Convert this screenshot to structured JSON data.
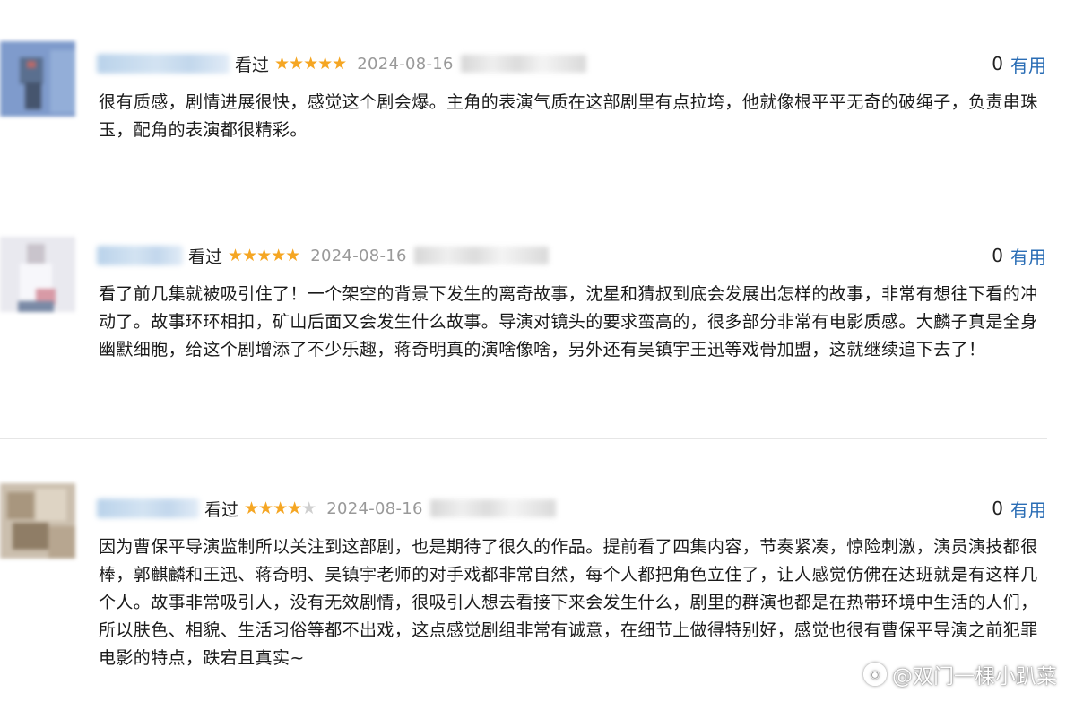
{
  "reviews": [
    {
      "status": "看过",
      "rating": 5,
      "stars": "★★★★★",
      "date": "2024-08-16",
      "useful_count": "0",
      "useful_label": "有用",
      "content": "很有质感，剧情进展很快，感觉这个剧会爆。主角的表演气质在这部剧里有点拉垮，他就像根平平无奇的破绳子，负责串珠玉，配角的表演都很精彩。"
    },
    {
      "status": "看过",
      "rating": 5,
      "stars": "★★★★★",
      "date": "2024-08-16",
      "useful_count": "0",
      "useful_label": "有用",
      "content": "看了前几集就被吸引住了！一个架空的背景下发生的离奇故事，沈星和猜叔到底会发展出怎样的故事，非常有想往下看的冲动了。故事环环相扣，矿山后面又会发生什么故事。导演对镜头的要求蛮高的，很多部分非常有电影质感。大麟子真是全身幽默细胞，给这个剧增添了不少乐趣，蒋奇明真的演啥像啥，另外还有吴镇宇王迅等戏骨加盟，这就继续追下去了！"
    },
    {
      "status": "看过",
      "rating": 4,
      "stars_on": "★★★★",
      "stars_off": "★",
      "date": "2024-08-16",
      "useful_count": "0",
      "useful_label": "有用",
      "content": "因为曹保平导演监制所以关注到这部剧，也是期待了很久的作品。提前看了四集内容，节奏紧凑，惊险刺激，演员演技都很棒，郭麒麟和王迅、蒋奇明、吴镇宇老师的对手戏都非常自然，每个人都把角色立住了，让人感觉仿佛在达班就是有这样几个人。故事非常吸引人，没有无效剧情，很吸引人想去看接下来会发生什么，剧里的群演也都是在热带环境中生活的人们，所以肤色、相貌、生活习俗等都不出戏，这点感觉剧组非常有诚意，在细节上做得特别好，感觉也很有曹保平导演之前犯罪电影的特点，跌宕且真实~"
    }
  ],
  "watermark": {
    "icon": "weibo-icon",
    "text": "@双门一棵小趴菜"
  },
  "colors": {
    "star": "#f5a623",
    "star_empty": "#cfcfcf",
    "link": "#2a6db5",
    "date": "#999999"
  }
}
